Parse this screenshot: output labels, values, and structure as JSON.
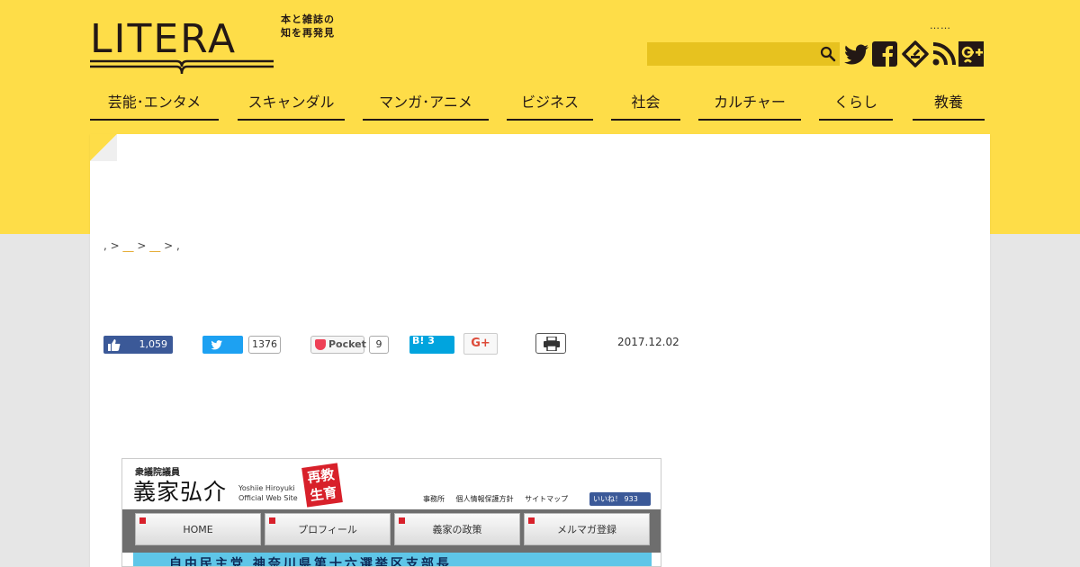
{
  "header": {
    "logo_text": "LITERA",
    "logo_tagline_line1": "本と雑誌の",
    "logo_tagline_line2": "知を再発見",
    "dots": "……",
    "search": {
      "placeholder": "",
      "value": ""
    },
    "social": [
      "twitter-icon",
      "facebook-icon",
      "feedly-icon",
      "rss-icon",
      "google-plus-icon"
    ]
  },
  "nav": {
    "items": [
      {
        "label": "芸能･エンタメ"
      },
      {
        "label": "スキャンダル"
      },
      {
        "label": "マンガ･アニメ"
      },
      {
        "label": "ビジネス"
      },
      {
        "label": "社会"
      },
      {
        "label": "カルチャー"
      },
      {
        "label": "くらし"
      },
      {
        "label": "教養"
      }
    ]
  },
  "breadcrumb": {
    "start": ",",
    "sep": ">",
    "link1": "__",
    "link2": "__",
    "end": ","
  },
  "share": {
    "facebook_count": "1,059",
    "twitter_count": "1376",
    "pocket_label": "Pocket",
    "pocket_count": "9",
    "hatena_label": "B! 3",
    "gplus_label": "G+"
  },
  "article": {
    "date": "2017.12.02"
  },
  "embedded_site": {
    "title_small": "衆議院議員",
    "name": "義家弘介",
    "roman_line1": "Yoshiie Hiroyuki",
    "roman_line2": "Official Web Site",
    "stamp_line1": "再教",
    "stamp_line2": "生育",
    "links": [
      "事務所",
      "個人情報保護方針",
      "サイトマップ"
    ],
    "like_label": "いいね！ 933",
    "nav": [
      "HOME",
      "プロフィール",
      "義家の政策",
      "メルマガ登録"
    ],
    "banner_text": "自由民主党 神奈川県第十六選挙区支部長"
  },
  "colors": {
    "brand_yellow": "#fedd48",
    "search_bg": "#e7c21f",
    "text_dark": "#231815",
    "link_orange": "#e3a320",
    "facebook": "#3b5998",
    "twitter": "#1da1f2",
    "hatena": "#00a4de"
  }
}
